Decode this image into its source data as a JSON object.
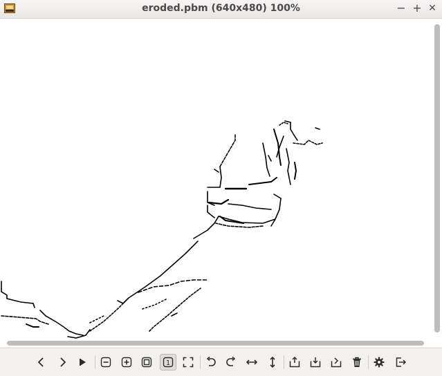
{
  "window": {
    "title": "eroded.pbm (640x480) 100%",
    "controls": {
      "minimize": "−",
      "maximize": "+",
      "close": "✕"
    }
  },
  "image": {
    "filename": "eroded.pbm",
    "width": 640,
    "height": 480,
    "zoom": "100%"
  },
  "toolbar": {
    "buttons": [
      {
        "name": "previous-icon"
      },
      {
        "name": "next-icon"
      },
      {
        "name": "slideshow-icon"
      },
      {
        "name": "zoom-out-icon"
      },
      {
        "name": "zoom-in-icon"
      },
      {
        "name": "zoom-fit-icon"
      },
      {
        "name": "zoom-original-icon",
        "label": "1",
        "active": true
      },
      {
        "name": "fullscreen-icon"
      },
      {
        "name": "rotate-left-icon"
      },
      {
        "name": "rotate-right-icon"
      },
      {
        "name": "flip-horizontal-icon"
      },
      {
        "name": "flip-vertical-icon"
      },
      {
        "name": "open-icon"
      },
      {
        "name": "save-icon"
      },
      {
        "name": "save-as-icon"
      },
      {
        "name": "delete-icon"
      },
      {
        "name": "preferences-icon"
      },
      {
        "name": "quit-icon"
      }
    ]
  },
  "colors": {
    "accent_icon": "#2c2c2c",
    "image_bg": "#ffffff",
    "image_fg": "#000000"
  }
}
